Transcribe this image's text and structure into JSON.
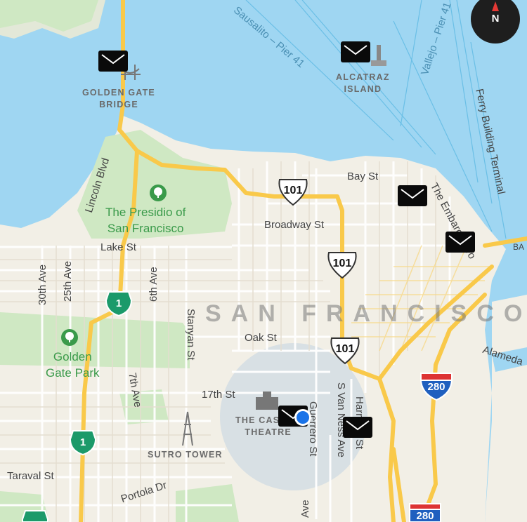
{
  "map": {
    "city_label": "SAN FRANCISCO",
    "parks": [
      {
        "id": "presidio",
        "line1": "The Presidio of",
        "line2": "San Francisco"
      },
      {
        "id": "golden-gate-park",
        "line1": "Golden",
        "line2": "Gate Park"
      }
    ],
    "pois": [
      {
        "id": "golden-gate-bridge",
        "line1": "GOLDEN GATE",
        "line2": "BRIDGE"
      },
      {
        "id": "alcatraz",
        "line1": "ALCATRAZ",
        "line2": "ISLAND"
      },
      {
        "id": "castro-theatre",
        "line1": "THE CASTRO",
        "line2": "THEATRE"
      },
      {
        "id": "sutro-tower",
        "line1": "SUTRO TOWER",
        "line2": ""
      }
    ],
    "streets": {
      "bay_st": "Bay St",
      "broadway_st": "Broadway St",
      "lake_st": "Lake St",
      "oak_st": "Oak St",
      "seventeenth_st": "17th St",
      "taraval_st": "Taraval St",
      "portola_dr": "Portola Dr",
      "lincoln_blvd": "Lincoln Blvd",
      "thirtieth_ave": "30th Ave",
      "twentyfifth_ave": "25th Ave",
      "sixth_ave": "6th Ave",
      "seventh_ave": "7th Ave",
      "stanyan_st": "Stanyan St",
      "guerrero_st": "Guerrero St",
      "south_van_ness_ave": "S Van Ness Ave",
      "harrison_st": "Harrison St",
      "embarcadero": "The Embarcadero",
      "ferry_building_terminal": "Ferry Building Terminal",
      "alameda": "Alameda",
      "sausalito_pier41": "Sausalito – Pier 41",
      "vallejo_pier41": "Vallejo – Pier 41",
      "bay_edge": "BA",
      "ave_edge": "Ave"
    },
    "highways": {
      "us101": "101",
      "ca1": "1",
      "i280": "280"
    },
    "compass": {
      "label": "N"
    },
    "markers_count": 6
  },
  "colors": {
    "water": "#9fd6f2",
    "land": "#f2efe6",
    "park": "#cfe8c3",
    "highway": "#f9c94a",
    "marker": "#0a0a0a",
    "shield_green": "#1b9a6a",
    "interstate_blue": "#1f5fbf",
    "interstate_red": "#d33"
  }
}
